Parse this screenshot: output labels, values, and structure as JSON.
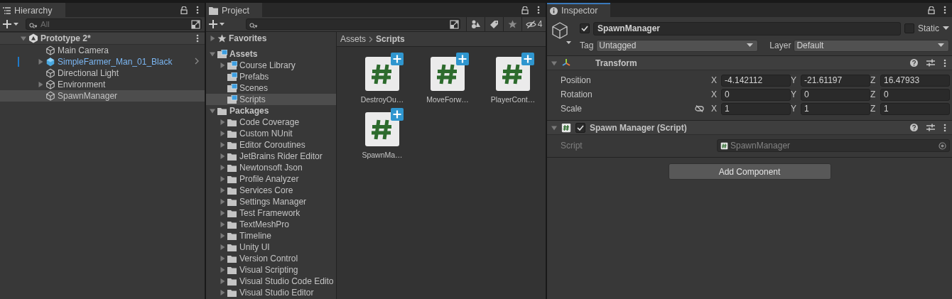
{
  "hierarchy": {
    "title": "Hierarchy",
    "search": {
      "placeholder": "All"
    },
    "scene": {
      "name": "Prototype 2*",
      "expanded": true,
      "children": [
        {
          "name": "Main Camera",
          "kind": "object",
          "selected": false
        },
        {
          "name": "SimpleFarmer_Man_01_Black",
          "kind": "prefab",
          "expanded": false,
          "selected": false
        },
        {
          "name": "Directional Light",
          "kind": "object",
          "selected": false
        },
        {
          "name": "Environment",
          "kind": "object",
          "expanded": false,
          "selected": false
        },
        {
          "name": "SpawnManager",
          "kind": "object",
          "selected": true
        }
      ]
    }
  },
  "project": {
    "title": "Project",
    "hidden_count": "4",
    "tree": [
      {
        "name": "Favorites",
        "kind": "favorites",
        "expanded": false,
        "selected": false
      },
      {
        "name": "Assets",
        "kind": "assets",
        "expanded": true,
        "selected": false,
        "children": [
          {
            "name": "Course Library",
            "kind": "asset_folder",
            "expanded": false,
            "selected": false
          },
          {
            "name": "Prefabs",
            "kind": "asset_folder",
            "selected": false
          },
          {
            "name": "Scenes",
            "kind": "asset_folder",
            "selected": false
          },
          {
            "name": "Scripts",
            "kind": "asset_folder",
            "selected": true
          }
        ]
      },
      {
        "name": "Packages",
        "kind": "packages",
        "expanded": true,
        "selected": false,
        "children": [
          {
            "name": "Code Coverage",
            "kind": "package",
            "expanded": false,
            "selected": false
          },
          {
            "name": "Custom NUnit",
            "kind": "package",
            "expanded": false,
            "selected": false
          },
          {
            "name": "Editor Coroutines",
            "kind": "package",
            "expanded": false,
            "selected": false
          },
          {
            "name": "JetBrains Rider Editor",
            "kind": "package",
            "expanded": false,
            "selected": false
          },
          {
            "name": "Newtonsoft Json",
            "kind": "package",
            "expanded": false,
            "selected": false
          },
          {
            "name": "Profile Analyzer",
            "kind": "package",
            "expanded": false,
            "selected": false
          },
          {
            "name": "Services Core",
            "kind": "package",
            "expanded": false,
            "selected": false
          },
          {
            "name": "Settings Manager",
            "kind": "package",
            "expanded": false,
            "selected": false
          },
          {
            "name": "Test Framework",
            "kind": "package",
            "expanded": false,
            "selected": false
          },
          {
            "name": "TextMeshPro",
            "kind": "package",
            "expanded": false,
            "selected": false
          },
          {
            "name": "Timeline",
            "kind": "package",
            "expanded": false,
            "selected": false
          },
          {
            "name": "Unity UI",
            "kind": "package",
            "expanded": false,
            "selected": false
          },
          {
            "name": "Version Control",
            "kind": "package",
            "expanded": false,
            "selected": false
          },
          {
            "name": "Visual Scripting",
            "kind": "package",
            "expanded": false,
            "selected": false
          },
          {
            "name": "Visual Studio Code Edito",
            "kind": "package",
            "expanded": false,
            "selected": false
          },
          {
            "name": "Visual Studio Editor",
            "kind": "package",
            "expanded": false,
            "selected": false
          }
        ]
      }
    ],
    "breadcrumb": [
      "Assets",
      "Scripts"
    ],
    "assets": [
      {
        "name": "DestroyOu…",
        "selected": false
      },
      {
        "name": "MoveForw…",
        "selected": false
      },
      {
        "name": "PlayerCont…",
        "selected": false
      },
      {
        "name": "SpawnMa…",
        "selected": false
      }
    ]
  },
  "inspector": {
    "title": "Inspector",
    "object": {
      "name": "SpawnManager",
      "active": true,
      "static": false,
      "static_label": "Static",
      "tag_label": "Tag",
      "tag": "Untagged",
      "layer_label": "Layer",
      "layer": "Default"
    },
    "components": [
      {
        "kind": "transform",
        "title": "Transform",
        "expanded": true,
        "rows": [
          {
            "label": "Position",
            "values": [
              {
                "axis": "X",
                "value": "-4.142112"
              },
              {
                "axis": "Y",
                "value": "-21.61197"
              },
              {
                "axis": "Z",
                "value": "16.47933"
              }
            ]
          },
          {
            "label": "Rotation",
            "values": [
              {
                "axis": "X",
                "value": "0"
              },
              {
                "axis": "Y",
                "value": "0"
              },
              {
                "axis": "Z",
                "value": "0"
              }
            ]
          },
          {
            "label": "Scale",
            "constrain_proportions": false,
            "values": [
              {
                "axis": "X",
                "value": "1"
              },
              {
                "axis": "Y",
                "value": "1"
              },
              {
                "axis": "Z",
                "value": "1"
              }
            ]
          }
        ]
      },
      {
        "kind": "script",
        "title": "Spawn Manager (Script)",
        "expanded": true,
        "enabled": true,
        "fields": [
          {
            "label": "Script",
            "value": "SpawnManager",
            "disabled": true
          }
        ]
      }
    ],
    "add_button": "Add Component"
  }
}
